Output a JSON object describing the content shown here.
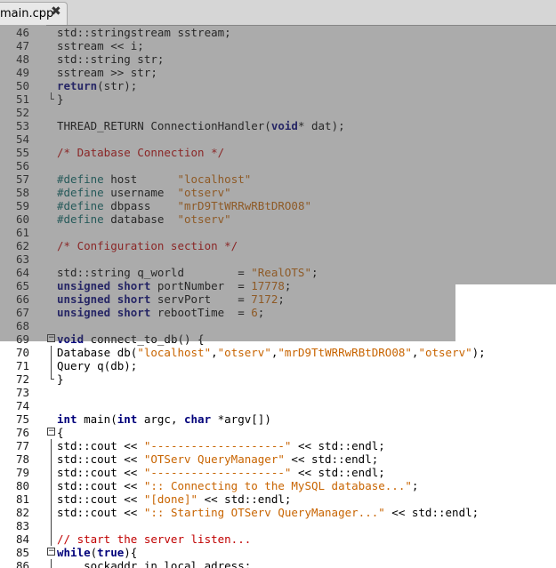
{
  "tab": {
    "title": "main.cpp",
    "close_glyph": "✖"
  },
  "lines": [
    {
      "n": "46",
      "t": [
        [
          "plain",
          "std::stringstream sstream;"
        ]
      ]
    },
    {
      "n": "47",
      "t": [
        [
          "plain",
          "sstream << i;"
        ]
      ]
    },
    {
      "n": "48",
      "t": [
        [
          "plain",
          "std::string str;"
        ]
      ]
    },
    {
      "n": "49",
      "t": [
        [
          "plain",
          "sstream >> str;"
        ]
      ]
    },
    {
      "n": "50",
      "t": [
        [
          "kw",
          "return"
        ],
        [
          "plain",
          "(str);"
        ]
      ]
    },
    {
      "n": "51",
      "t": [
        [
          "plain",
          "}"
        ]
      ],
      "fold": "end"
    },
    {
      "n": "52",
      "t": []
    },
    {
      "n": "53",
      "t": [
        [
          "plain",
          "THREAD_RETURN ConnectionHandler("
        ],
        [
          "kw",
          "void"
        ],
        [
          "plain",
          "* dat);"
        ]
      ]
    },
    {
      "n": "54",
      "t": []
    },
    {
      "n": "55",
      "t": [
        [
          "cmt",
          "/* Database Connection */"
        ]
      ]
    },
    {
      "n": "56",
      "t": []
    },
    {
      "n": "57",
      "t": [
        [
          "pp",
          "#define"
        ],
        [
          "plain",
          " host      "
        ],
        [
          "str",
          "\"localhost\""
        ]
      ]
    },
    {
      "n": "58",
      "t": [
        [
          "pp",
          "#define"
        ],
        [
          "plain",
          " username  "
        ],
        [
          "str",
          "\"otserv\""
        ]
      ]
    },
    {
      "n": "59",
      "t": [
        [
          "pp",
          "#define"
        ],
        [
          "plain",
          " dbpass    "
        ],
        [
          "str",
          "\"mrD9TtWRRwRBtDRO08\""
        ]
      ]
    },
    {
      "n": "60",
      "t": [
        [
          "pp",
          "#define"
        ],
        [
          "plain",
          " database  "
        ],
        [
          "str",
          "\"otserv\""
        ]
      ]
    },
    {
      "n": "61",
      "t": []
    },
    {
      "n": "62",
      "t": [
        [
          "cmt",
          "/* Configuration section */"
        ]
      ]
    },
    {
      "n": "63",
      "t": []
    },
    {
      "n": "64",
      "t": [
        [
          "plain",
          "std::string q_world        = "
        ],
        [
          "str",
          "\"RealOTS\""
        ],
        [
          "plain",
          ";"
        ]
      ]
    },
    {
      "n": "65",
      "t": [
        [
          "kw",
          "unsigned short"
        ],
        [
          "plain",
          " portNumber  = "
        ],
        [
          "num",
          "17778"
        ],
        [
          "plain",
          ";"
        ]
      ]
    },
    {
      "n": "66",
      "t": [
        [
          "kw",
          "unsigned short"
        ],
        [
          "plain",
          " servPort    = "
        ],
        [
          "num",
          "7172"
        ],
        [
          "plain",
          ";"
        ]
      ]
    },
    {
      "n": "67",
      "t": [
        [
          "kw",
          "unsigned short"
        ],
        [
          "plain",
          " rebootTime  = "
        ],
        [
          "num",
          "6"
        ],
        [
          "plain",
          ";"
        ]
      ]
    },
    {
      "n": "68",
      "t": []
    },
    {
      "n": "69",
      "t": [
        [
          "kw",
          "void"
        ],
        [
          "plain",
          " connect_to_db() {"
        ]
      ],
      "fold": "start"
    },
    {
      "n": "70",
      "t": [
        [
          "plain",
          "Database db("
        ],
        [
          "str",
          "\"localhost\""
        ],
        [
          "plain",
          ","
        ],
        [
          "str",
          "\"otserv\""
        ],
        [
          "plain",
          ","
        ],
        [
          "str",
          "\"mrD9TtWRRwRBtDRO08\""
        ],
        [
          "plain",
          ","
        ],
        [
          "str",
          "\"otserv\""
        ],
        [
          "plain",
          ");"
        ]
      ],
      "fold": "mid"
    },
    {
      "n": "71",
      "t": [
        [
          "plain",
          "Query q(db);"
        ]
      ],
      "fold": "mid"
    },
    {
      "n": "72",
      "t": [
        [
          "plain",
          "}"
        ]
      ],
      "fold": "end"
    },
    {
      "n": "73",
      "t": []
    },
    {
      "n": "74",
      "t": []
    },
    {
      "n": "75",
      "t": [
        [
          "kw",
          "int"
        ],
        [
          "plain",
          " main("
        ],
        [
          "kw",
          "int"
        ],
        [
          "plain",
          " argc, "
        ],
        [
          "kw",
          "char"
        ],
        [
          "plain",
          " *argv[])"
        ]
      ]
    },
    {
      "n": "76",
      "t": [
        [
          "plain",
          "{"
        ]
      ],
      "fold": "start"
    },
    {
      "n": "77",
      "t": [
        [
          "plain",
          "std::cout << "
        ],
        [
          "str",
          "\"--------------------\""
        ],
        [
          "plain",
          " << std::endl;"
        ]
      ],
      "fold": "mid"
    },
    {
      "n": "78",
      "t": [
        [
          "plain",
          "std::cout << "
        ],
        [
          "str",
          "\"OTServ QueryManager\""
        ],
        [
          "plain",
          " << std::endl;"
        ]
      ],
      "fold": "mid"
    },
    {
      "n": "79",
      "t": [
        [
          "plain",
          "std::cout << "
        ],
        [
          "str",
          "\"--------------------\""
        ],
        [
          "plain",
          " << std::endl;"
        ]
      ],
      "fold": "mid"
    },
    {
      "n": "80",
      "t": [
        [
          "plain",
          "std::cout << "
        ],
        [
          "str",
          "\":: Connecting to the MySQL database...\""
        ],
        [
          "plain",
          ";"
        ]
      ],
      "fold": "mid"
    },
    {
      "n": "81",
      "t": [
        [
          "plain",
          "std::cout << "
        ],
        [
          "str",
          "\"[done]\""
        ],
        [
          "plain",
          " << std::endl;"
        ]
      ],
      "fold": "mid"
    },
    {
      "n": "82",
      "t": [
        [
          "plain",
          "std::cout << "
        ],
        [
          "str",
          "\":: Starting OTServ QueryManager...\""
        ],
        [
          "plain",
          " << std::endl;"
        ]
      ],
      "fold": "mid"
    },
    {
      "n": "83",
      "t": [],
      "fold": "mid"
    },
    {
      "n": "84",
      "t": [
        [
          "cmt",
          "// start the server listen..."
        ]
      ],
      "fold": "mid"
    },
    {
      "n": "85",
      "t": [
        [
          "kw",
          "while"
        ],
        [
          "plain",
          "("
        ],
        [
          "kw",
          "true"
        ],
        [
          "plain",
          "){"
        ]
      ],
      "fold": "start"
    },
    {
      "n": "86",
      "t": [
        [
          "plain",
          "    sockaddr_in local_adress;"
        ]
      ],
      "fold": "mid"
    }
  ]
}
